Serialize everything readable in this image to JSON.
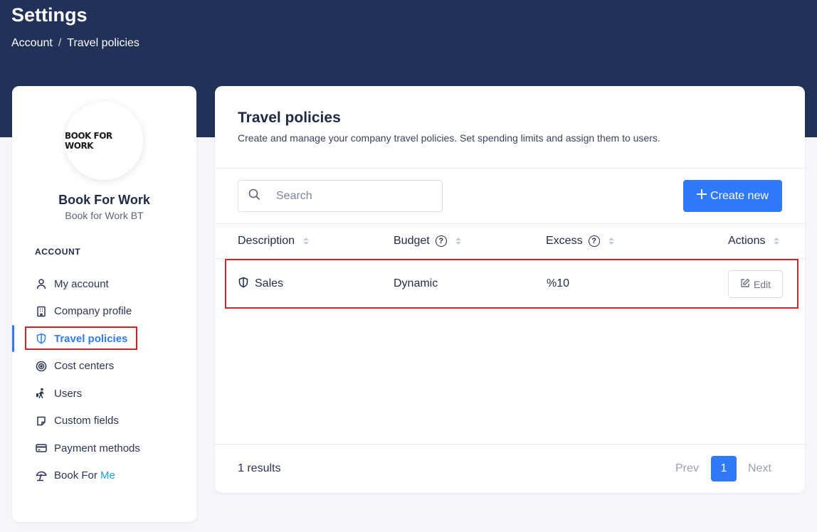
{
  "header": {
    "title": "Settings",
    "breadcrumb": [
      "Account",
      "Travel policies"
    ],
    "breadcrumb_sep": "/"
  },
  "sidebar": {
    "logo_text": "BOOK FOR WORK",
    "company_name": "Book For Work",
    "company_sub": "Book for Work BT",
    "section_label": "ACCOUNT",
    "items": [
      {
        "label": "My account",
        "icon": "user-icon"
      },
      {
        "label": "Company profile",
        "icon": "building-icon"
      },
      {
        "label": "Travel policies",
        "icon": "shield-icon",
        "active": true
      },
      {
        "label": "Cost centers",
        "icon": "target-icon"
      },
      {
        "label": "Users",
        "icon": "traveler-icon"
      },
      {
        "label": "Custom fields",
        "icon": "note-icon"
      },
      {
        "label": "Payment methods",
        "icon": "credit-card-icon"
      },
      {
        "label": "Book For ",
        "label_accent": "Me",
        "icon": "beach-umbrella-icon"
      }
    ]
  },
  "main": {
    "title": "Travel policies",
    "description": "Create and manage your company travel policies. Set spending limits and assign them to users.",
    "search_placeholder": "Search",
    "create_label": "Create new",
    "columns": [
      "Description",
      "Budget",
      "Excess",
      "Actions"
    ],
    "rows": [
      {
        "description": "Sales",
        "budget": "Dynamic",
        "excess": "%10",
        "action": "Edit"
      }
    ],
    "results": "1 results",
    "pagination": {
      "prev": "Prev",
      "current": "1",
      "next": "Next"
    }
  },
  "colors": {
    "header_bg": "#213158",
    "accent": "#2f7af8",
    "highlight": "#d91f26"
  }
}
